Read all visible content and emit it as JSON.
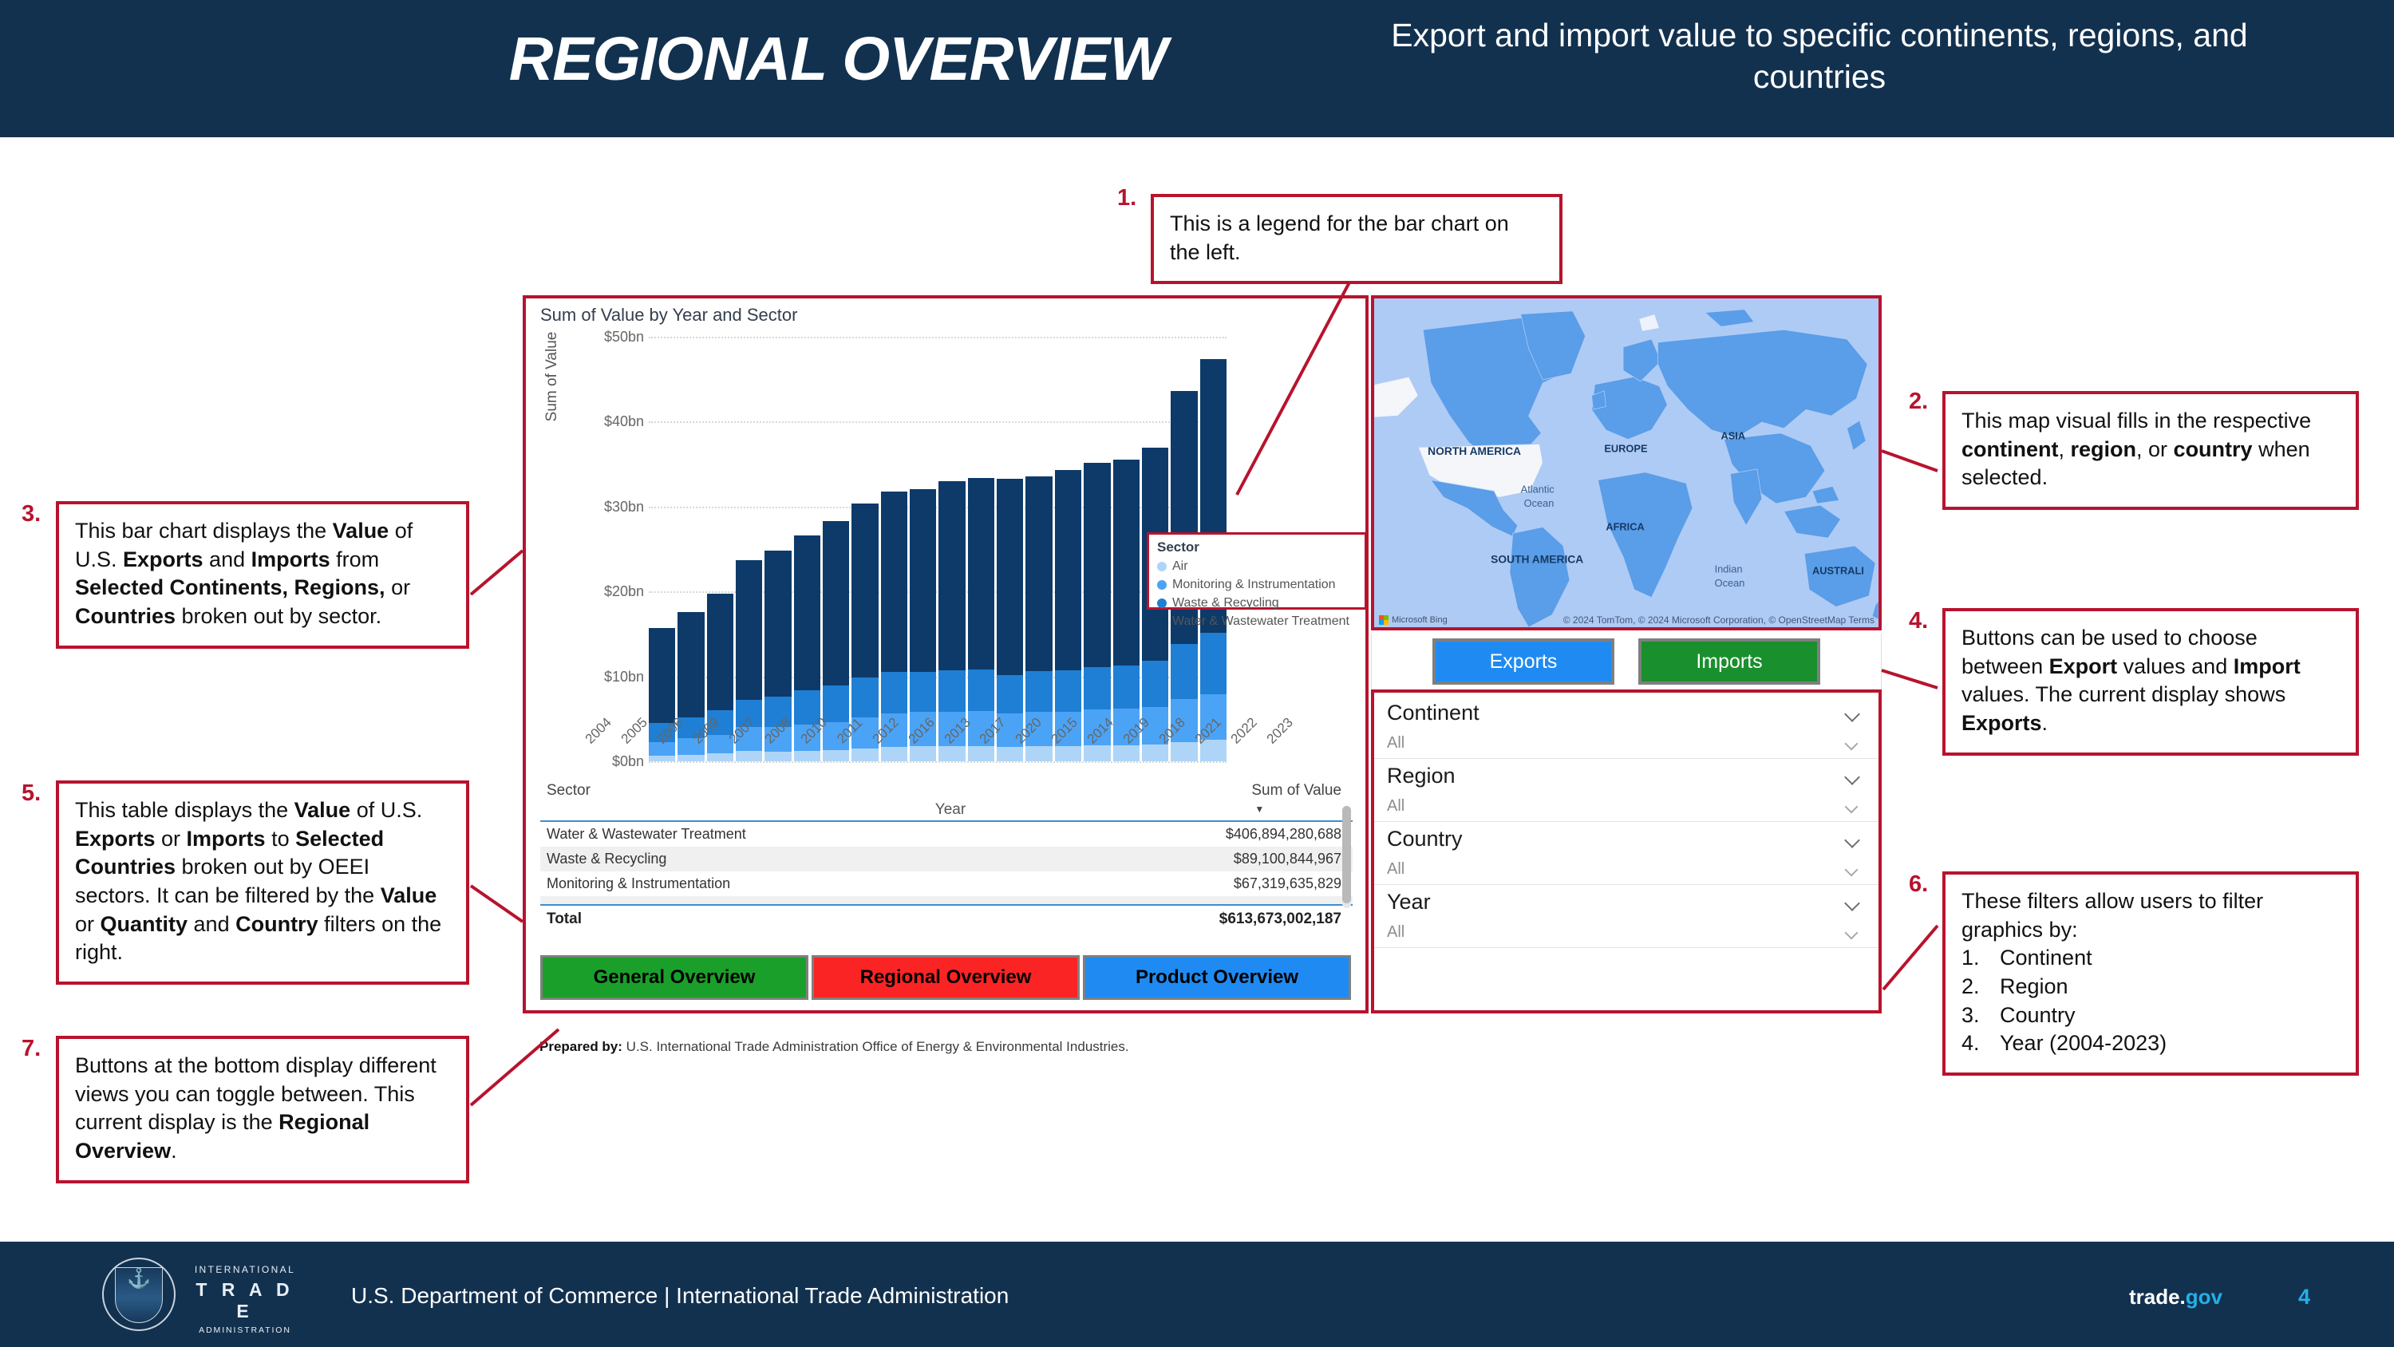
{
  "header": {
    "title": "REGIONAL OVERVIEW",
    "subtitle": "Export and import value to specific continents, regions, and countries"
  },
  "footer": {
    "org_top": "INTERNATIONAL",
    "org_mid": "T R A D E",
    "org_bot": "ADMINISTRATION",
    "agency": "U.S. Department of Commerce | International Trade Administration",
    "trade_word": "trade.",
    "trade_gov": "gov",
    "page_number": "4"
  },
  "dashboard": {
    "chart_title": "Sum of Value by Year and Sector",
    "legend": {
      "title": "Sector",
      "items": [
        {
          "label": "Air",
          "color": "#aed5f7"
        },
        {
          "label": "Monitoring & Instrumentation",
          "color": "#4ba3f5"
        },
        {
          "label": "Waste & Recycling",
          "color": "#1f7fd4"
        },
        {
          "label": "Water & Wastewater Treatment",
          "color": "#0d3a69"
        }
      ]
    },
    "table": {
      "col_sector": "Sector",
      "col_value": "Sum of Value",
      "rows": [
        {
          "sector": "Water & Wastewater Treatment",
          "value": "$406,894,280,688"
        },
        {
          "sector": "Waste & Recycling",
          "value": "$89,100,844,967"
        },
        {
          "sector": "Monitoring & Instrumentation",
          "value": "$67,319,635,829"
        }
      ],
      "total_label": "Total",
      "total_value": "$613,673,002,187"
    },
    "nav_buttons": [
      {
        "label": "General Overview",
        "color": "#1aa02a"
      },
      {
        "label": "Regional Overview",
        "color": "#fb2424"
      },
      {
        "label": "Product Overview",
        "color": "#1f8bf2"
      }
    ],
    "prepared_bold": "Prepared by:",
    "prepared_rest": " U.S. International Trade Administration Office of Energy & Environmental Industries.",
    "map": {
      "labels": [
        "NORTH AMERICA",
        "SOUTH AMERICA",
        "EUROPE",
        "AFRICA",
        "ASIA",
        "AUSTRALI"
      ],
      "oceans": [
        "Atlantic Ocean",
        "Indian Ocean"
      ],
      "credit": "© 2024 TomTom, © 2024 Microsoft Corporation, © OpenStreetMap  Terms",
      "provider": "Microsoft Bing"
    },
    "toggles": [
      {
        "label": "Exports",
        "color": "#1f8bf2"
      },
      {
        "label": "Imports",
        "color": "#1a8f2e"
      }
    ],
    "filters": [
      {
        "name": "Continent",
        "value": "All"
      },
      {
        "name": "Region",
        "value": "All"
      },
      {
        "name": "Country",
        "value": "All"
      },
      {
        "name": "Year",
        "value": "All"
      }
    ]
  },
  "callouts": {
    "c1": {
      "num": "1.",
      "text": "This is a legend for the bar chart on the left."
    },
    "c2": {
      "num": "2.",
      "p1": "This map visual fills in the respective ",
      "b1": "continent",
      "p2": ", ",
      "b2": "region",
      "p3": ", or ",
      "b3": "country",
      "p4": " when selected."
    },
    "c3": {
      "num": "3.",
      "p1": "This bar chart displays the ",
      "b1": "Value",
      "p2": " of U.S. ",
      "b2": "Exports",
      "p3": " and ",
      "b3": "Imports",
      "p4": " from ",
      "b4": "Selected Continents, Regions,",
      "p5": " or ",
      "b5": "Countries",
      "p6": " broken out by sector."
    },
    "c4": {
      "num": "4.",
      "p1": "Buttons can be used to choose between ",
      "b1": "Export",
      "p2": " values and ",
      "b2": "Import",
      "p3": " values. The current display shows ",
      "b3": "Exports",
      "p4": "."
    },
    "c5": {
      "num": "5.",
      "p1": "This table displays the ",
      "b1": "Value",
      "p2": " of U.S. ",
      "b2": "Exports",
      "p3": " or ",
      "b3": "Imports",
      "p4": " to ",
      "b4": "Selected Countries",
      "p5": " broken out by OEEI sectors. It can be filtered by the ",
      "b5": "Value",
      "p6": " or ",
      "b6": "Quantity",
      "p7": " and ",
      "b7": "Country",
      "p8": " filters on the right."
    },
    "c6": {
      "num": "6.",
      "intro": "These filters allow users to filter graphics by:",
      "items": [
        {
          "n": "1.",
          "t": "Continent"
        },
        {
          "n": "2.",
          "t": "Region"
        },
        {
          "n": "3.",
          "t": "Country"
        },
        {
          "n": "4.",
          "t": "Year (2004-2023)"
        }
      ]
    },
    "c7": {
      "num": "7.",
      "p1": "Buttons at the bottom display different views you can toggle between. This current display is the ",
      "b1": "Regional Overview",
      "p2": "."
    }
  },
  "chart_data": {
    "type": "bar",
    "subtype": "stacked",
    "title": "Sum of Value by Year and Sector",
    "xlabel": "Year",
    "ylabel": "Sum of Value",
    "ylim": [
      0,
      50
    ],
    "yunit": "bn",
    "ytick_labels": [
      "$0bn",
      "$10bn",
      "$20bn",
      "$30bn",
      "$40bn",
      "$50bn"
    ],
    "ytick_values": [
      0,
      10,
      20,
      30,
      40,
      50
    ],
    "grid": true,
    "legend_position": "right-inside",
    "categories": [
      "2004",
      "2005",
      "2006",
      "2009",
      "2007",
      "2008",
      "2010",
      "2011",
      "2012",
      "2016",
      "2013",
      "2017",
      "2020",
      "2015",
      "2014",
      "2019",
      "2018",
      "2021",
      "2022",
      "2023"
    ],
    "series": [
      {
        "name": "Air",
        "color": "#aed5f7",
        "values": [
          0.7,
          0.8,
          0.9,
          1.2,
          1.1,
          1.2,
          1.3,
          1.5,
          1.7,
          1.8,
          1.8,
          1.8,
          1.7,
          1.8,
          1.8,
          1.9,
          1.9,
          2.0,
          2.3,
          2.5
        ]
      },
      {
        "name": "Monitoring & Instrumentation",
        "color": "#4ba3f5",
        "values": [
          1.6,
          1.9,
          2.2,
          2.8,
          2.9,
          3.1,
          3.3,
          3.7,
          3.9,
          4.0,
          4.0,
          4.1,
          3.9,
          4.0,
          4.0,
          4.2,
          4.3,
          4.4,
          5.0,
          5.4
        ]
      },
      {
        "name": "Waste & Recycling",
        "color": "#1f7fd4",
        "values": [
          2.2,
          2.5,
          2.9,
          3.2,
          3.6,
          4.1,
          4.3,
          4.7,
          4.9,
          4.7,
          4.9,
          4.9,
          4.6,
          4.8,
          4.9,
          5.0,
          5.1,
          5.4,
          6.5,
          7.2
        ]
      },
      {
        "name": "Water & Wastewater Treatment",
        "color": "#0d3a69",
        "values": [
          11.2,
          12.4,
          13.7,
          16.5,
          17.2,
          18.2,
          19.4,
          20.5,
          21.3,
          21.6,
          22.3,
          22.6,
          23.1,
          23.0,
          23.6,
          24.1,
          24.2,
          25.1,
          29.8,
          32.3
        ]
      }
    ],
    "totals": [
      15.7,
      17.6,
      19.7,
      23.7,
      24.8,
      26.6,
      28.3,
      30.4,
      31.8,
      32.1,
      33.0,
      33.4,
      33.3,
      33.6,
      34.3,
      35.2,
      35.5,
      36.9,
      43.6,
      47.4
    ]
  }
}
